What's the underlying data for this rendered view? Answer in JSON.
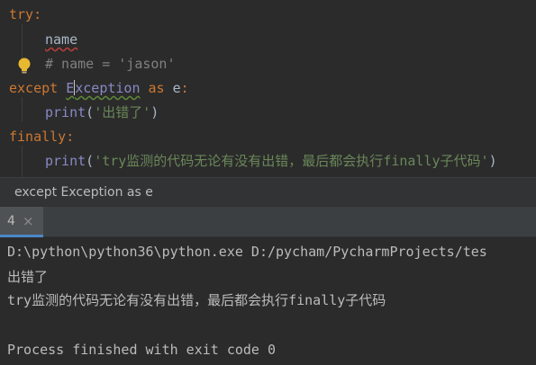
{
  "editor": {
    "line1": {
      "kw": "try",
      "punct": ":"
    },
    "line2": {
      "text": "name"
    },
    "line3": {
      "text": "# name = 'jason'"
    },
    "line4": {
      "kw": "except",
      "cls_first": "E",
      "cls_rest": "xception",
      "as": "as",
      "var": "e",
      "punct": ":"
    },
    "line5": {
      "fn": "print",
      "open": "(",
      "str": "'出错了'",
      "close": ")"
    },
    "line6": {
      "kw": "finally",
      "punct": ":"
    },
    "line7": {
      "fn": "print",
      "open": "(",
      "str": "'try监测的代码无论有没有出错，最后都会执行finally子代码'",
      "close": ")"
    },
    "bulb_icon": "lightbulb-icon"
  },
  "breadcrumb": {
    "text": "except Exception as e"
  },
  "run_tab": {
    "label": "4",
    "close_icon": "close-icon"
  },
  "console": {
    "lines": [
      "D:\\python\\python36\\python.exe D:/pycham/PycharmProjects/tes",
      "出错了",
      "try监测的代码无论有没有出错，最后都会执行finally子代码",
      "",
      "Process finished with exit code 0"
    ]
  },
  "colors": {
    "background": "#2b2b2b",
    "keyword": "#cc7832",
    "builtin": "#8888c6",
    "string": "#6a8759",
    "comment": "#808080"
  }
}
